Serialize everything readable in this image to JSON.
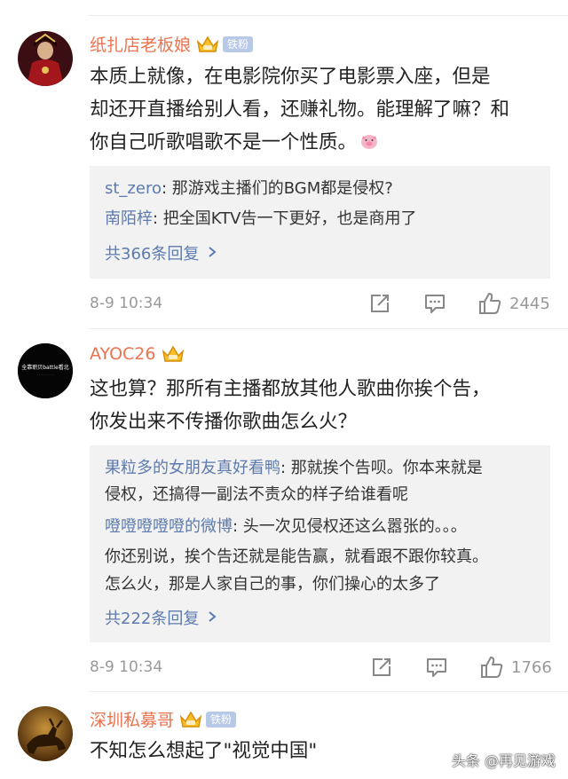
{
  "comments": [
    {
      "username": "纸扎店老板娘",
      "badge": "铁粉",
      "lines": [
        "本质上就像，在电影院你买了电影票入座，但是",
        "却还开直播给别人看，还赚礼物。能理解了嘛？和",
        "你自己听歌唱歌不是一个性质。"
      ],
      "replies": [
        {
          "name": "st_zero",
          "text": ": 那游戏主播们的BGM都是侵权?"
        },
        {
          "name": "南陌梓",
          "text": ": 把全国KTV告一下更好，也是商用了"
        }
      ],
      "more_replies": "共366条回复",
      "time": "8-9 10:34",
      "likes": "2445"
    },
    {
      "username": "AYOC26",
      "avatar_text": "全靠职贝battle看北",
      "lines": [
        "这也算？那所有主播都放其他人歌曲你挨个告，",
        "你发出来不传播你歌曲怎么火？"
      ],
      "replies": [
        {
          "name": "果粒多的女朋友真好看鸭",
          "text": ": 那就挨个告呗。你本来就是",
          "cont": "侵权，还搞得一副法不责众的样子给谁看呢"
        },
        {
          "name": "噔噔噔噔噔的微博",
          "text": ": 头一次见侵权还这么嚣张的。。。",
          "cont": "你还别说，挨个告还就是能告赢，就看跟不跟你较真。",
          "cont2": "怎么火，那是人家自己的事，你们操心的太多了"
        }
      ],
      "more_replies": "共222条回复",
      "time": "8-9 10:34",
      "likes": "1766"
    },
    {
      "username": "深圳私募哥",
      "badge": "铁粉",
      "lines": [
        "不知怎么想起了\"视觉中国\""
      ]
    }
  ],
  "watermark": "头条 @再见游戏",
  "icons": [
    "repost-icon",
    "comment-icon",
    "like-icon",
    "crown-icon",
    "chevron-right-icon"
  ],
  "colors": {
    "username": "#eb7350",
    "reply_name": "#5d7bae",
    "badge": "#b7c9e6",
    "reply_bg": "#f2f2f2",
    "meta": "#999999"
  }
}
